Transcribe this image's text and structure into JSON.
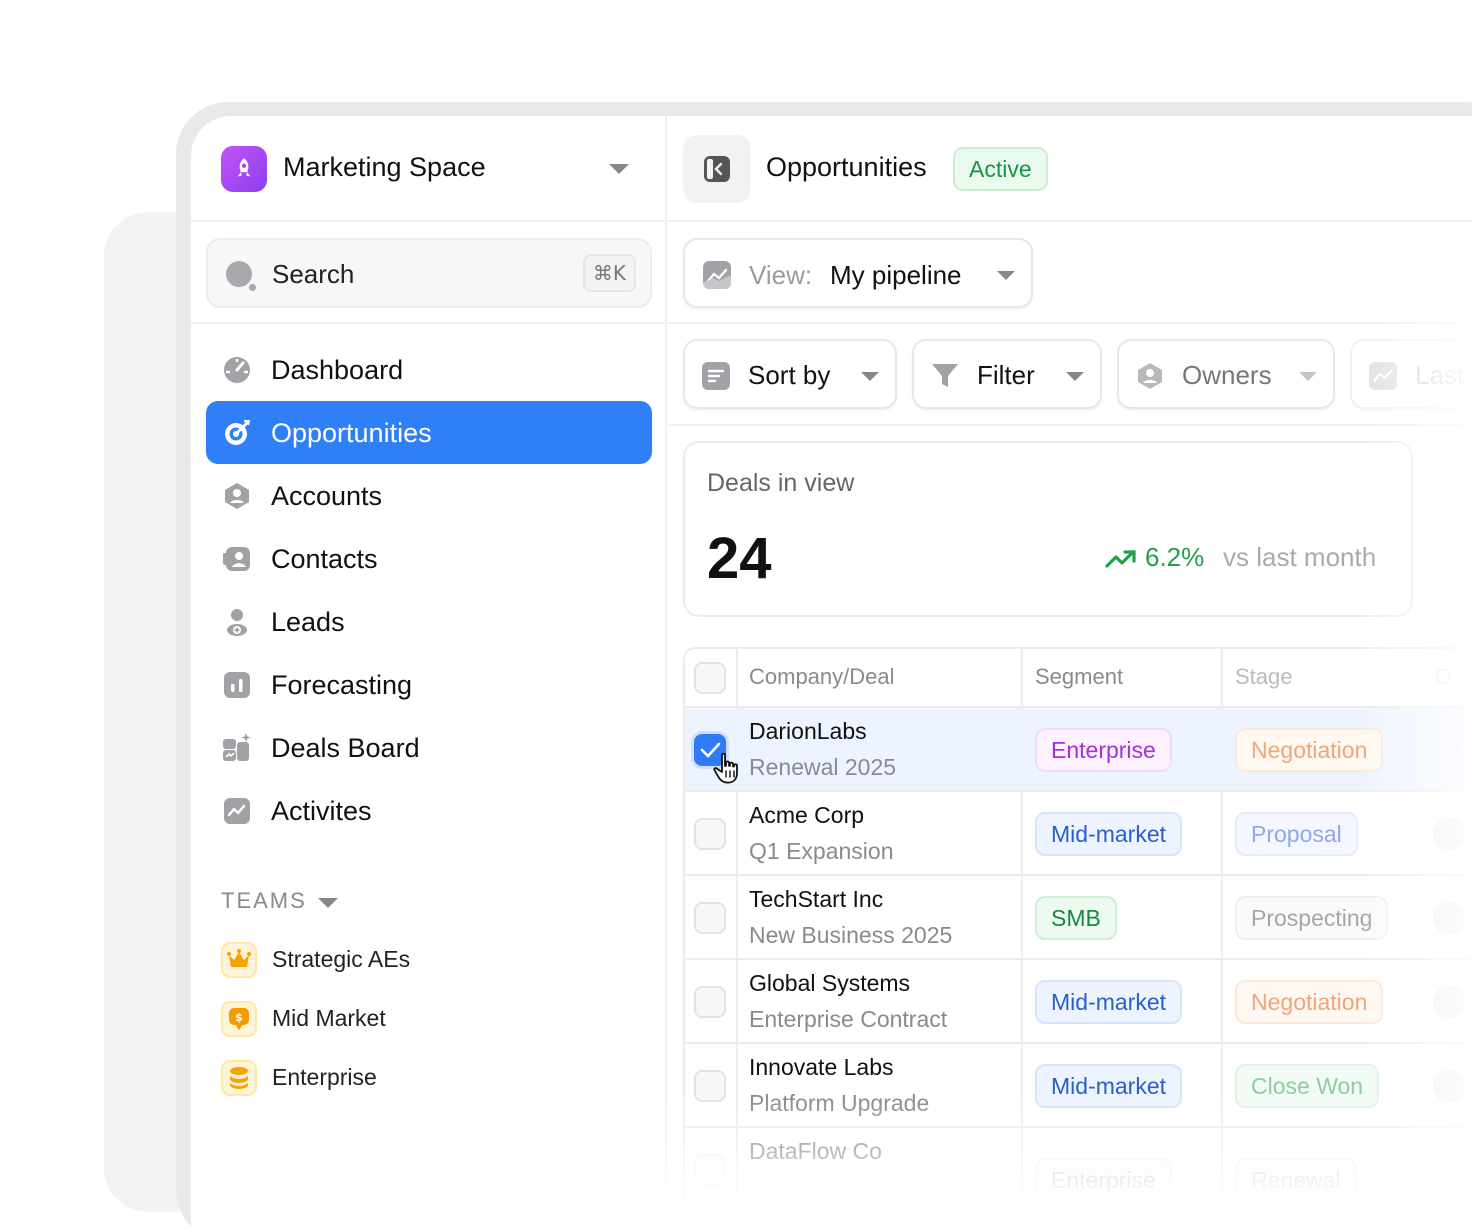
{
  "colors": {
    "accent": "#2f80f6",
    "success": "#16963f",
    "brand": "#a346f3"
  },
  "workspace": {
    "name": "Marketing Space",
    "logo_icon": "rocket-icon"
  },
  "search": {
    "label": "Search",
    "shortcut": "⌘K"
  },
  "sidebar": {
    "items": [
      {
        "label": "Dashboard",
        "icon": "gauge-icon"
      },
      {
        "label": "Opportunities",
        "icon": "target-icon",
        "active": true
      },
      {
        "label": "Accounts",
        "icon": "account-hex-icon"
      },
      {
        "label": "Contacts",
        "icon": "contact-card-icon"
      },
      {
        "label": "Leads",
        "icon": "person-add-icon"
      },
      {
        "label": "Forecasting",
        "icon": "bar-chart-icon"
      },
      {
        "label": "Deals Board",
        "icon": "board-sparkle-icon"
      },
      {
        "label": "Activites",
        "icon": "activity-icon"
      }
    ],
    "teams_header": "TEAMS",
    "teams": [
      {
        "label": "Strategic AEs",
        "icon": "crown-icon"
      },
      {
        "label": "Mid Market",
        "icon": "dollar-bubble-icon"
      },
      {
        "label": "Enterprise",
        "icon": "database-icon"
      }
    ]
  },
  "header": {
    "title": "Opportunities",
    "status": "Active"
  },
  "view": {
    "prefix": "View:",
    "value": "My pipeline"
  },
  "toolbar": {
    "sort": "Sort by",
    "filter": "Filter",
    "owners": "Owners",
    "last": "Last"
  },
  "kpi": {
    "label": "Deals in view",
    "value": "24",
    "delta": "6.2%",
    "compare": "vs last month"
  },
  "table": {
    "columns": [
      "Company/Deal",
      "Segment",
      "Stage",
      "O"
    ],
    "rows": [
      {
        "company": "DarionLabs",
        "deal": "Renewal 2025",
        "segment": "Enterprise",
        "stage": "Negotiation",
        "owner": "S",
        "selected": true
      },
      {
        "company": "Acme Corp",
        "deal": "Q1 Expansion",
        "segment": "Mid-market",
        "stage": "Proposal"
      },
      {
        "company": "TechStart Inc",
        "deal": "New Business 2025",
        "segment": "SMB",
        "stage": "Prospecting"
      },
      {
        "company": "Global Systems",
        "deal": "Enterprise Contract",
        "segment": "Mid-market",
        "stage": "Negotiation"
      },
      {
        "company": "Innovate Labs",
        "deal": "Platform Upgrade",
        "segment": "Mid-market",
        "stage": "Close Won"
      },
      {
        "company": "DataFlow Co",
        "deal": "",
        "segment": "Enterprise",
        "stage": "Renewal"
      }
    ]
  }
}
